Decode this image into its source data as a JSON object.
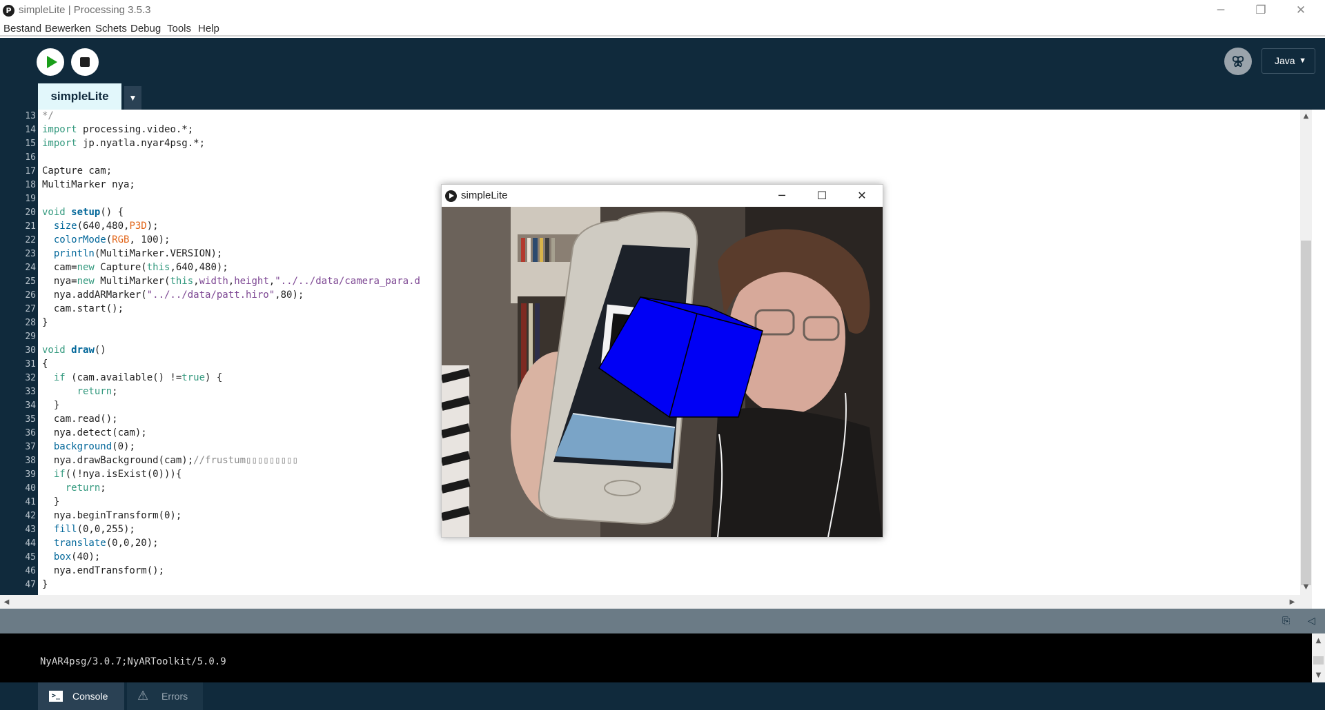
{
  "window": {
    "title": "simpleLite | Processing 3.5.3",
    "app_icon_glyph": "P",
    "controls": {
      "minimize": "─",
      "restore": "❐",
      "close": "✕"
    }
  },
  "menu": [
    "Bestand",
    "Bewerken",
    "Schets",
    "Debug",
    "Tools",
    "Help"
  ],
  "toolbar": {
    "run_icon": "play-icon",
    "stop_icon": "stop-icon",
    "debug_icon": "butterfly-icon",
    "mode": "Java",
    "mode_caret": "▼"
  },
  "tabs": {
    "active": "simpleLite",
    "menu_glyph": "▼"
  },
  "editor": {
    "lines": [
      {
        "n": "13",
        "parts": [
          {
            "t": "*/",
            "c": "cmt"
          }
        ]
      },
      {
        "n": "14",
        "parts": [
          {
            "t": "import",
            "c": "kw"
          },
          {
            "t": " processing.video.*;",
            "c": ""
          }
        ]
      },
      {
        "n": "15",
        "parts": [
          {
            "t": "import",
            "c": "kw"
          },
          {
            "t": " jp.nyatla.nyar4psg.*;",
            "c": ""
          }
        ]
      },
      {
        "n": "16",
        "parts": []
      },
      {
        "n": "17",
        "parts": [
          {
            "t": "Capture cam;",
            "c": ""
          }
        ]
      },
      {
        "n": "18",
        "parts": [
          {
            "t": "MultiMarker nya;",
            "c": ""
          }
        ]
      },
      {
        "n": "19",
        "parts": []
      },
      {
        "n": "20",
        "parts": [
          {
            "t": "void",
            "c": "kw"
          },
          {
            "t": " ",
            "c": ""
          },
          {
            "t": "setup",
            "c": "fnb"
          },
          {
            "t": "() {",
            "c": ""
          }
        ]
      },
      {
        "n": "21",
        "parts": [
          {
            "t": "  ",
            "c": ""
          },
          {
            "t": "size",
            "c": "fn"
          },
          {
            "t": "(640,480,",
            "c": ""
          },
          {
            "t": "P3D",
            "c": "lit"
          },
          {
            "t": ");",
            "c": ""
          }
        ]
      },
      {
        "n": "22",
        "parts": [
          {
            "t": "  ",
            "c": ""
          },
          {
            "t": "colorMode",
            "c": "fn"
          },
          {
            "t": "(",
            "c": ""
          },
          {
            "t": "RGB",
            "c": "lit"
          },
          {
            "t": ", 100);",
            "c": ""
          }
        ]
      },
      {
        "n": "23",
        "parts": [
          {
            "t": "  ",
            "c": ""
          },
          {
            "t": "println",
            "c": "fn"
          },
          {
            "t": "(MultiMarker.VERSION);",
            "c": ""
          }
        ]
      },
      {
        "n": "24",
        "parts": [
          {
            "t": "  cam=",
            "c": ""
          },
          {
            "t": "new",
            "c": "kw"
          },
          {
            "t": " Capture(",
            "c": ""
          },
          {
            "t": "this",
            "c": "kw"
          },
          {
            "t": ",640,480);",
            "c": ""
          }
        ]
      },
      {
        "n": "25",
        "parts": [
          {
            "t": "  nya=",
            "c": ""
          },
          {
            "t": "new",
            "c": "kw"
          },
          {
            "t": " MultiMarker(",
            "c": ""
          },
          {
            "t": "this",
            "c": "kw"
          },
          {
            "t": ",",
            "c": ""
          },
          {
            "t": "width",
            "c": "str"
          },
          {
            "t": ",",
            "c": ""
          },
          {
            "t": "height",
            "c": "str"
          },
          {
            "t": ",",
            "c": ""
          },
          {
            "t": "\"../../data/camera_para.d",
            "c": "str"
          }
        ]
      },
      {
        "n": "26",
        "parts": [
          {
            "t": "  nya.addARMarker(",
            "c": ""
          },
          {
            "t": "\"../../data/patt.hiro\"",
            "c": "str"
          },
          {
            "t": ",80);",
            "c": ""
          }
        ]
      },
      {
        "n": "27",
        "parts": [
          {
            "t": "  cam.start();",
            "c": ""
          }
        ]
      },
      {
        "n": "28",
        "parts": [
          {
            "t": "}",
            "c": ""
          }
        ]
      },
      {
        "n": "29",
        "parts": []
      },
      {
        "n": "30",
        "parts": [
          {
            "t": "void",
            "c": "kw"
          },
          {
            "t": " ",
            "c": ""
          },
          {
            "t": "draw",
            "c": "fnb"
          },
          {
            "t": "()",
            "c": ""
          }
        ]
      },
      {
        "n": "31",
        "parts": [
          {
            "t": "{",
            "c": ""
          }
        ]
      },
      {
        "n": "32",
        "parts": [
          {
            "t": "  ",
            "c": ""
          },
          {
            "t": "if",
            "c": "kw"
          },
          {
            "t": " (cam.available() !=",
            "c": ""
          },
          {
            "t": "true",
            "c": "kw"
          },
          {
            "t": ") {",
            "c": ""
          }
        ]
      },
      {
        "n": "33",
        "parts": [
          {
            "t": "      ",
            "c": ""
          },
          {
            "t": "return",
            "c": "kw"
          },
          {
            "t": ";",
            "c": ""
          }
        ]
      },
      {
        "n": "34",
        "parts": [
          {
            "t": "  }",
            "c": ""
          }
        ]
      },
      {
        "n": "35",
        "parts": [
          {
            "t": "  cam.read();",
            "c": ""
          }
        ]
      },
      {
        "n": "36",
        "parts": [
          {
            "t": "  nya.detect(cam);",
            "c": ""
          }
        ]
      },
      {
        "n": "37",
        "parts": [
          {
            "t": "  ",
            "c": ""
          },
          {
            "t": "background",
            "c": "fn"
          },
          {
            "t": "(0);",
            "c": ""
          }
        ]
      },
      {
        "n": "38",
        "parts": [
          {
            "t": "  nya.drawBackground(cam);",
            "c": ""
          },
          {
            "t": "//frustum▯▯▯▯▯▯▯▯▯",
            "c": "cmt"
          }
        ]
      },
      {
        "n": "39",
        "parts": [
          {
            "t": "  ",
            "c": ""
          },
          {
            "t": "if",
            "c": "kw"
          },
          {
            "t": "((!nya.isExist(0))){",
            "c": ""
          }
        ]
      },
      {
        "n": "40",
        "parts": [
          {
            "t": "    ",
            "c": ""
          },
          {
            "t": "return",
            "c": "kw"
          },
          {
            "t": ";",
            "c": ""
          }
        ]
      },
      {
        "n": "41",
        "parts": [
          {
            "t": "  }",
            "c": ""
          }
        ]
      },
      {
        "n": "42",
        "parts": [
          {
            "t": "  nya.beginTransform(0);",
            "c": ""
          }
        ]
      },
      {
        "n": "43",
        "parts": [
          {
            "t": "  ",
            "c": ""
          },
          {
            "t": "fill",
            "c": "fn"
          },
          {
            "t": "(0,0,255);",
            "c": ""
          }
        ]
      },
      {
        "n": "44",
        "parts": [
          {
            "t": "  ",
            "c": ""
          },
          {
            "t": "translate",
            "c": "fn"
          },
          {
            "t": "(0,0,20);",
            "c": ""
          }
        ]
      },
      {
        "n": "45",
        "parts": [
          {
            "t": "  ",
            "c": ""
          },
          {
            "t": "box",
            "c": "fn"
          },
          {
            "t": "(40);",
            "c": ""
          }
        ]
      },
      {
        "n": "46",
        "parts": [
          {
            "t": "  nya.endTransform();",
            "c": ""
          }
        ]
      },
      {
        "n": "47",
        "parts": [
          {
            "t": "}",
            "c": ""
          }
        ]
      }
    ]
  },
  "sketch_window": {
    "title": "simpleLite",
    "controls": {
      "minimize": "─",
      "maximize": "☐",
      "close": "✕"
    }
  },
  "console": {
    "output": "NyAR4psg/3.0.7;NyARToolkit/5.0.9",
    "copy_icon": "⎘",
    "collapse_icon": "◁"
  },
  "footer_tabs": {
    "console": "Console",
    "errors": "Errors",
    "console_icon_glyph": ">_",
    "errors_icon_glyph": "⚠"
  },
  "scroll": {
    "up": "▲",
    "down": "▼",
    "left": "◀",
    "right": "▶"
  },
  "colors": {
    "toolbar_bg": "#102a3c",
    "cube": "#0000f5",
    "run_green": "#1a9e1a"
  }
}
